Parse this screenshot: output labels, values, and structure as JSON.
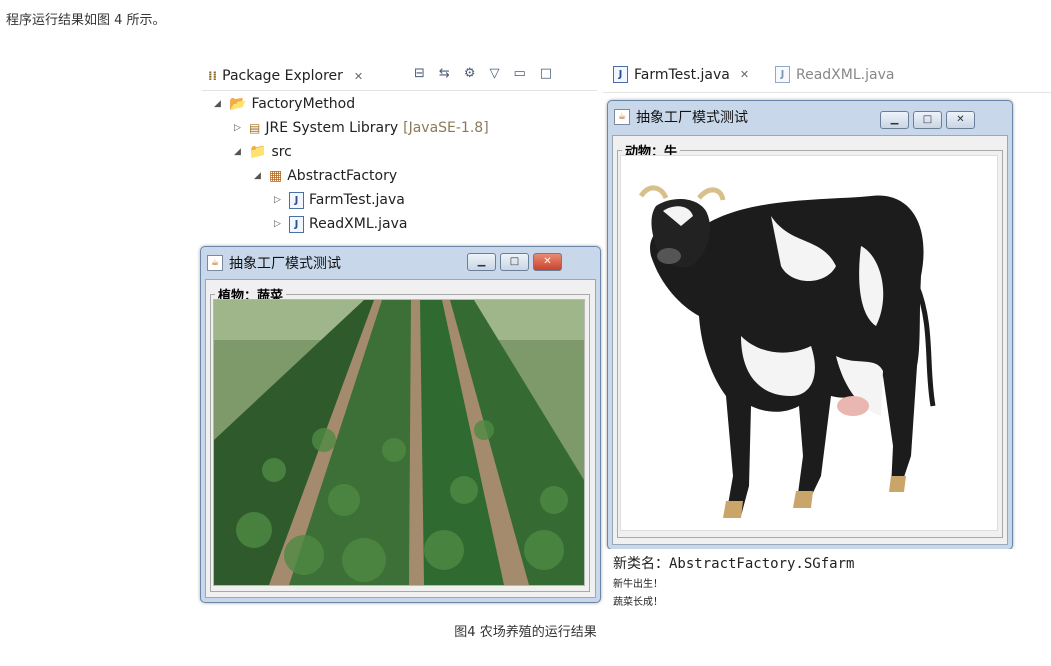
{
  "intro": "程序运行结果如图 4 所示。",
  "caption": "图4 农场养殖的运行结果",
  "package_explorer": {
    "title": "Package Explorer",
    "title_icon": "package-explorer-icon",
    "tree": [
      {
        "label": "FactoryMethod",
        "icon": "project-folder-icon",
        "expanded": true
      },
      {
        "label": "JRE System Library",
        "suffix": "[JavaSE-1.8]",
        "icon": "library-icon",
        "expanded": false
      },
      {
        "label": "src",
        "icon": "source-folder-icon",
        "expanded": true
      },
      {
        "label": "AbstractFactory",
        "icon": "package-icon",
        "expanded": true
      },
      {
        "label": "FarmTest.java",
        "icon": "java-file-icon",
        "expanded": false
      },
      {
        "label": "ReadXML.java",
        "icon": "java-file-icon",
        "expanded": false
      }
    ]
  },
  "editor": {
    "tabs": [
      {
        "label": "FarmTest.java",
        "active": true
      },
      {
        "label": "ReadXML.java",
        "active": false
      }
    ]
  },
  "plant_window": {
    "title": "抽象工厂模式测试",
    "group_label": "植物：蔬菜",
    "image": "vegetable-field"
  },
  "animal_window": {
    "title": "抽象工厂模式测试",
    "group_label": "动物：牛",
    "image": "cow"
  },
  "console": {
    "lines": [
      "新类名：AbstractFactory.SGfarm",
      "新牛出生！",
      "蔬菜长成！"
    ]
  },
  "colors": {
    "window_frame": "#c8d8ea",
    "close_button": "#c8432a"
  }
}
